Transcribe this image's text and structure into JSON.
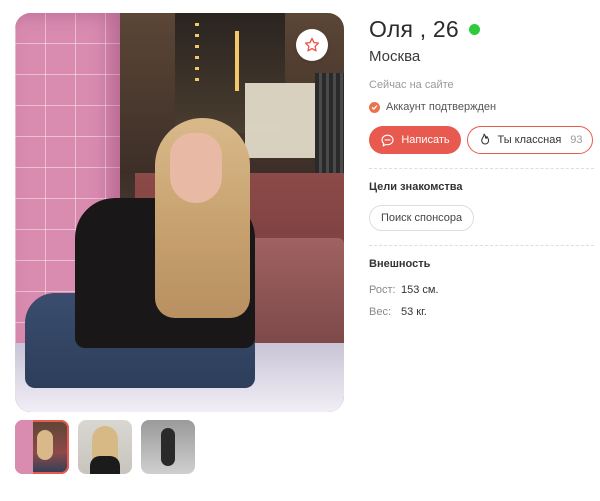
{
  "profile": {
    "name": "Оля , 26",
    "city": "Москва",
    "status": "Сейчас на сайте",
    "verified": "Аккаунт подтвержден",
    "online_color": "#2ecc3a"
  },
  "actions": {
    "write_label": "Написать",
    "like_label": "Ты классная",
    "like_count": "93",
    "accent_color": "#e85a4f"
  },
  "goals": {
    "title": "Цели знакомства",
    "items": [
      "Поиск спонсора"
    ]
  },
  "appearance": {
    "title": "Внешность",
    "height_label": "Рост:",
    "height_value": "153 см.",
    "weight_label": "Вес:",
    "weight_value": "53 кг."
  },
  "gallery": {
    "photo_count": 3,
    "selected_index": 0,
    "icons": [
      "star-icon",
      "chat-icon",
      "flame-icon",
      "check-icon"
    ]
  }
}
